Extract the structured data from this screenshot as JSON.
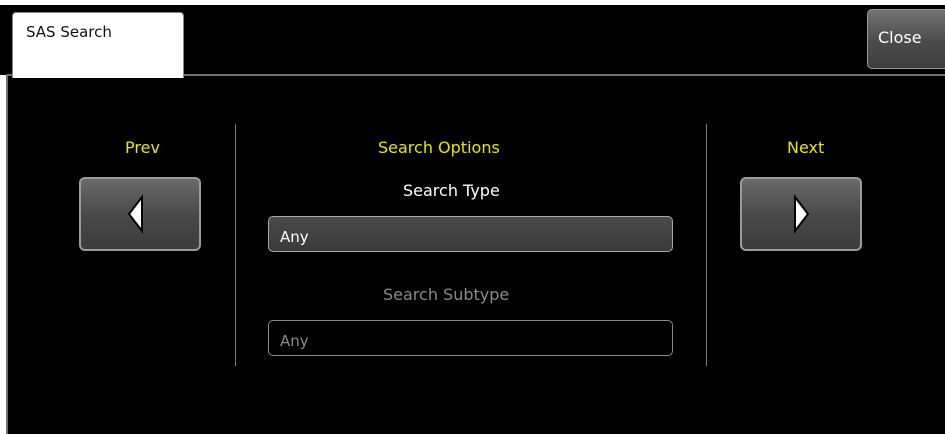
{
  "tab": {
    "label": "SAS Search"
  },
  "toolbar": {
    "close_label": "Close"
  },
  "navigation": {
    "prev_label": "Prev",
    "next_label": "Next"
  },
  "search_options": {
    "heading": "Search Options",
    "search_type_label": "Search Type",
    "search_type_value": "Any",
    "search_subtype_label": "Search Subtype",
    "search_subtype_value": "Any"
  },
  "colors": {
    "accent_yellow": "#e6e600",
    "panel_background": "#000000",
    "disabled_text": "#8a8a8a"
  },
  "icons": {
    "prev": "left-triangle-icon",
    "next": "right-triangle-icon"
  }
}
